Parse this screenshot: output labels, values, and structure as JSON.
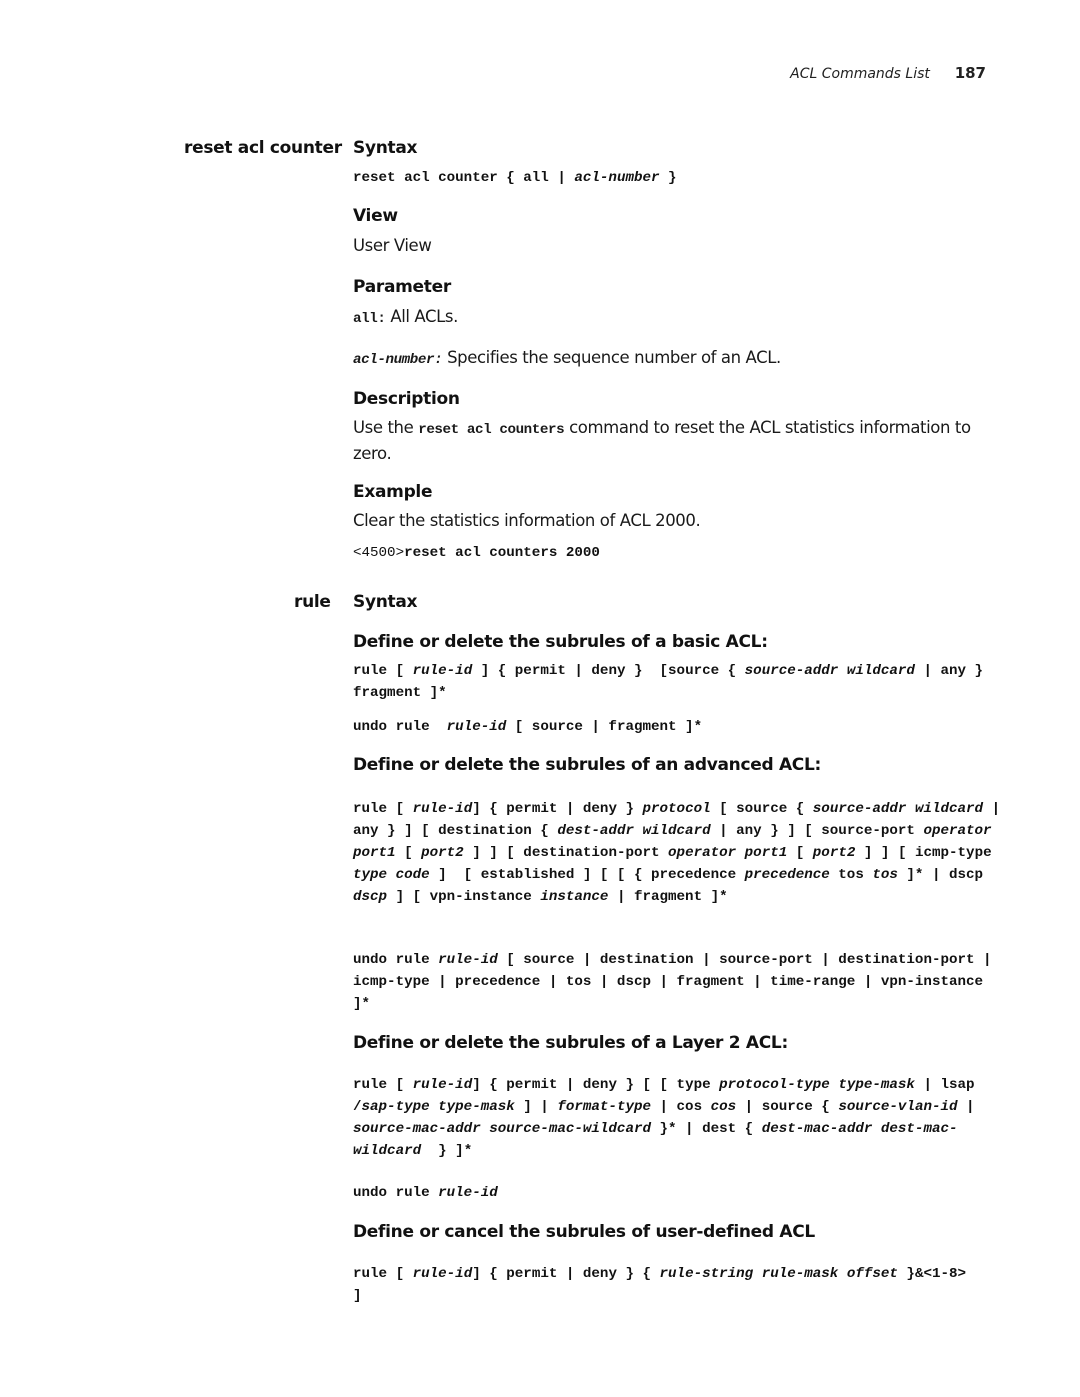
{
  "header": {
    "title": "ACL Commands List",
    "page": "187"
  },
  "reset": {
    "command": "reset acl counter",
    "syntax_heading": "Syntax",
    "syntax": [
      [
        [
          "reset acl counter { all | ",
          ""
        ],
        [
          "acl-number",
          "i"
        ],
        [
          " }",
          ""
        ]
      ]
    ],
    "view_heading": "View",
    "view": "User View",
    "parameter_heading": "Parameter",
    "param_all_term": "all:",
    "param_all_desc": " All ACLs.",
    "param_num_term": "acl-number:",
    "param_num_desc": " Specifies the sequence number of an ACL.",
    "description_heading": "Description",
    "desc_pre": "Use the ",
    "desc_code": "reset acl counters",
    "desc_post": " command to reset the ACL statistics information to zero.",
    "example_heading": "Example",
    "example_text": "Clear the statistics information of ACL 2000.",
    "example_code": [
      [
        [
          "<4500>",
          "n"
        ],
        [
          "reset acl counters 2000",
          ""
        ]
      ]
    ]
  },
  "rule": {
    "command": "rule",
    "syntax_heading": "Syntax",
    "basic_heading": "Define or delete the subrules of a basic ACL:",
    "basic_code": [
      [
        [
          "rule [ ",
          ""
        ],
        [
          "rule-id",
          "i"
        ],
        [
          " ] { permit | deny }  [source { ",
          ""
        ],
        [
          "source-addr wildcard",
          "i"
        ],
        [
          " | any } fragment ]*",
          ""
        ]
      ]
    ],
    "basic_undo": [
      [
        [
          "undo rule  ",
          ""
        ],
        [
          "rule-id",
          "i"
        ],
        [
          " [ source | fragment ]*",
          ""
        ]
      ]
    ],
    "advanced_heading": "Define or delete the subrules of an advanced ACL:",
    "advanced_code": [
      [
        [
          "rule [ ",
          ""
        ],
        [
          "rule-id",
          "i"
        ],
        [
          "] { permit | deny } ",
          ""
        ],
        [
          "protocol",
          "i"
        ],
        [
          " [ source { ",
          ""
        ],
        [
          "source-addr wildcard",
          "i"
        ],
        [
          " | any } ] [ destination { ",
          ""
        ],
        [
          "dest-addr wildcard",
          "i"
        ],
        [
          " | any } ] [ source-port ",
          ""
        ],
        [
          "operator port1",
          "i"
        ],
        [
          " [ ",
          ""
        ],
        [
          "port2",
          "i"
        ],
        [
          " ] ] [ destination-port ",
          ""
        ],
        [
          "operator port1",
          "i"
        ],
        [
          " [ ",
          ""
        ],
        [
          "port2",
          "i"
        ],
        [
          " ] ] [ icmp-type ",
          ""
        ],
        [
          "type code",
          "i"
        ],
        [
          " ]  [ established ] [ [ { precedence ",
          ""
        ],
        [
          "precedence",
          "i"
        ],
        [
          " tos ",
          ""
        ],
        [
          "tos",
          "i"
        ],
        [
          " ]* | dscp ",
          ""
        ],
        [
          "dscp",
          "i"
        ],
        [
          " ] [ vpn-instance ",
          ""
        ],
        [
          "instance",
          "i"
        ],
        [
          " | fragment ]*",
          ""
        ]
      ]
    ],
    "advanced_undo": [
      [
        [
          "undo rule ",
          ""
        ],
        [
          "rule-id",
          "i"
        ],
        [
          " [ source | destination | source-port | destination-port | icmp-type | precedence | tos | dscp | fragment | time-range | vpn-instance ]*",
          ""
        ]
      ]
    ],
    "layer2_heading": "Define or delete the subrules of a Layer 2 ACL:",
    "layer2_code": [
      [
        [
          "rule [ ",
          ""
        ],
        [
          "rule-id",
          "i"
        ],
        [
          "] { permit | deny } [ [ type ",
          ""
        ],
        [
          "protocol-type type-mask",
          "i"
        ],
        [
          " | lsap /",
          ""
        ],
        [
          "sap-type type-mask",
          "i"
        ],
        [
          " ] | ",
          ""
        ],
        [
          "format-type",
          "i"
        ],
        [
          " | cos ",
          ""
        ],
        [
          "cos",
          "i"
        ],
        [
          " | source { ",
          ""
        ],
        [
          "source-vlan-id",
          "i"
        ],
        [
          " | ",
          ""
        ],
        [
          "source-mac-addr source-mac-wildcard",
          "i"
        ],
        [
          " }* | dest { ",
          ""
        ],
        [
          "dest-mac-addr dest-mac-wildcard",
          "i"
        ],
        [
          "  } ]*",
          ""
        ]
      ]
    ],
    "layer2_undo": [
      [
        [
          "undo rule ",
          ""
        ],
        [
          "rule-id",
          "i"
        ]
      ]
    ],
    "user_heading": "Define or cancel the subrules of user-defined ACL",
    "user_code": [
      [
        [
          "rule [ ",
          ""
        ],
        [
          "rule-id",
          "i"
        ],
        [
          "] { permit | deny } { ",
          ""
        ],
        [
          "rule-string rule-mask offset",
          "i"
        ],
        [
          " }&<1-8> ]",
          ""
        ]
      ]
    ]
  }
}
